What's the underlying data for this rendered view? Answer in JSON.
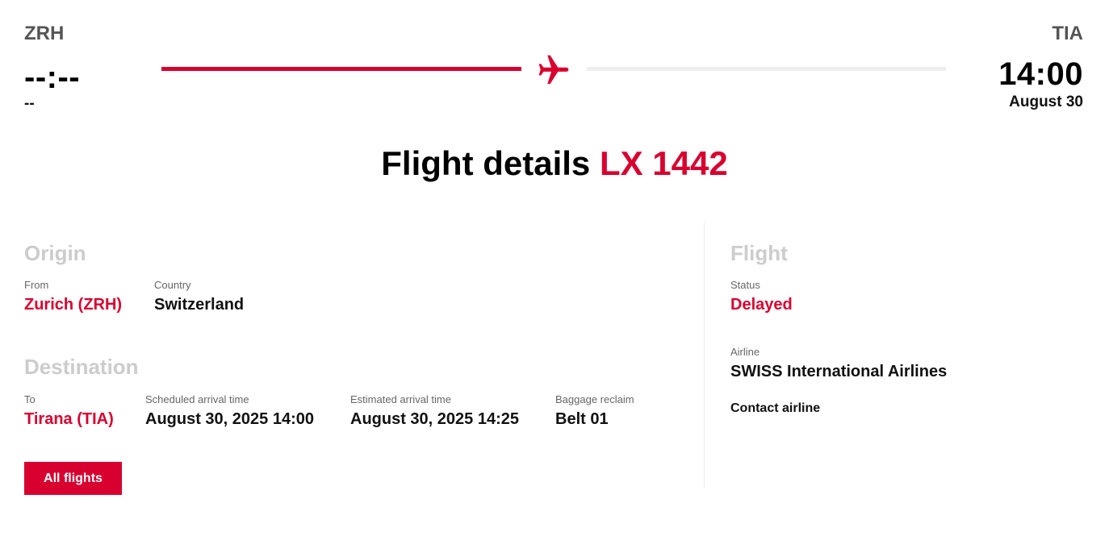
{
  "route": {
    "origin": {
      "iata": "ZRH",
      "time": "--:--",
      "date": "--"
    },
    "destination": {
      "iata": "TIA",
      "time": "14:00",
      "date": "August 30"
    },
    "progress_fraction": 0.5,
    "icon": "airplane-icon"
  },
  "title": {
    "prefix": "Flight details",
    "flight_number": "LX 1442"
  },
  "origin_section": {
    "heading": "Origin",
    "from": {
      "label": "From",
      "value": "Zurich (ZRH)"
    },
    "country": {
      "label": "Country",
      "value": "Switzerland"
    }
  },
  "destination_section": {
    "heading": "Destination",
    "to": {
      "label": "To",
      "value": "Tirana (TIA)"
    },
    "scheduled": {
      "label": "Scheduled arrival time",
      "value": "August 30, 2025 14:00"
    },
    "estimated": {
      "label": "Estimated arrival time",
      "value": "August 30, 2025 14:25"
    },
    "baggage": {
      "label": "Baggage reclaim",
      "value": "Belt 01"
    }
  },
  "flight_section": {
    "heading": "Flight",
    "status": {
      "label": "Status",
      "value": "Delayed"
    },
    "airline": {
      "label": "Airline",
      "value": "SWISS International Airlines"
    },
    "contact_label": "Contact airline"
  },
  "actions": {
    "all_flights_label": "All flights"
  },
  "colors": {
    "accent": "#d8002f",
    "muted_heading": "#cccccc",
    "track": "#eeeeee"
  }
}
